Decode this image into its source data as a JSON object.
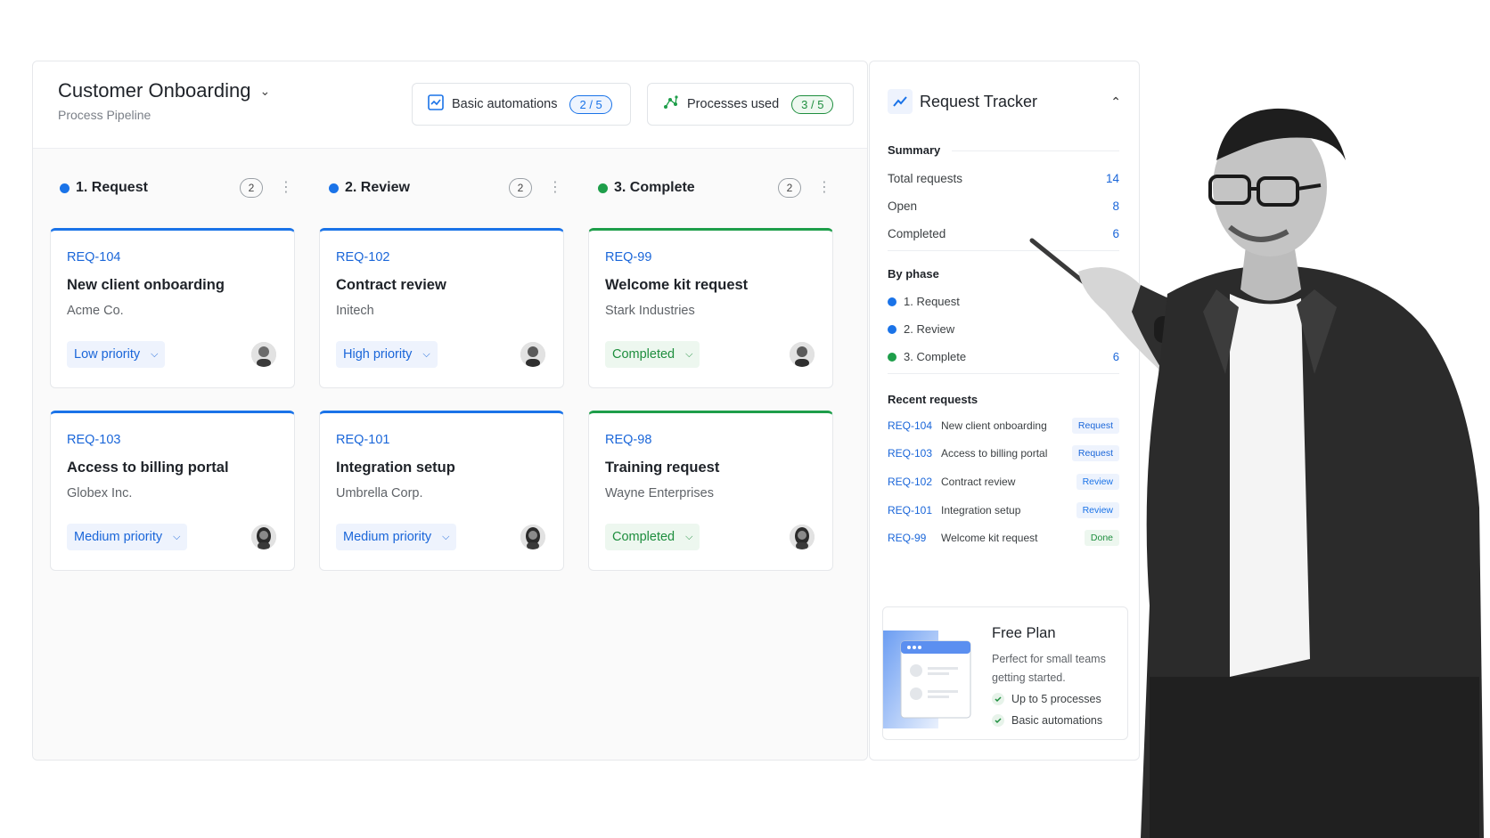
{
  "board": {
    "title": "Customer Onboarding",
    "subtitle": "Process Pipeline",
    "stats": [
      {
        "label": "Basic automations",
        "count": "2 / 5"
      },
      {
        "label": "Processes used",
        "count": "3 / 5"
      }
    ]
  },
  "columns": [
    {
      "title": "1. Request",
      "count": "2",
      "cards": [
        {
          "id": "REQ-104",
          "title": "New client onboarding",
          "client": "Acme Co.",
          "tag": "Low priority"
        },
        {
          "id": "REQ-103",
          "title": "Access to billing portal",
          "client": "Globex Inc.",
          "tag": "Medium priority"
        }
      ]
    },
    {
      "title": "2. Review",
      "count": "2",
      "cards": [
        {
          "id": "REQ-102",
          "title": "Contract review",
          "client": "Initech",
          "tag": "High priority"
        },
        {
          "id": "REQ-101",
          "title": "Integration setup",
          "client": "Umbrella Corp.",
          "tag": "Medium priority"
        }
      ]
    },
    {
      "title": "3. Complete",
      "count": "2",
      "cards": [
        {
          "id": "REQ-99",
          "title": "Welcome kit request",
          "client": "Stark Industries",
          "tag": "Completed"
        },
        {
          "id": "REQ-98",
          "title": "Training request",
          "client": "Wayne Enterprises",
          "tag": "Completed"
        }
      ]
    }
  ],
  "tracker": {
    "title": "Request Tracker",
    "summary_label": "Summary",
    "summary": [
      {
        "label": "Total requests",
        "value": "14"
      },
      {
        "label": "Open",
        "value": "8"
      },
      {
        "label": "Completed",
        "value": "6"
      }
    ],
    "phase_label": "By phase",
    "phases": [
      {
        "label": "1. Request",
        "value": ""
      },
      {
        "label": "2. Review",
        "value": ""
      },
      {
        "label": "3. Complete",
        "value": "6"
      }
    ],
    "recent_label": "Recent requests",
    "recent": [
      {
        "id": "REQ-104",
        "title": "New client onboarding",
        "badge": "Request"
      },
      {
        "id": "REQ-103",
        "title": "Access to billing portal",
        "badge": "Request"
      },
      {
        "id": "REQ-102",
        "title": "Contract review",
        "badge": "Review"
      },
      {
        "id": "REQ-101",
        "title": "Integration setup",
        "badge": "Review"
      },
      {
        "id": "REQ-99",
        "title": "Welcome kit request",
        "badge": "Done"
      }
    ],
    "plan": {
      "title": "Free Plan",
      "description": "Perfect for small teams getting started.",
      "features": [
        "Up to 5 processes",
        "Basic automations"
      ]
    }
  },
  "colors": {
    "blue": "#1a73e8",
    "green": "#1e9e4a",
    "border": "#e6e8eb"
  }
}
